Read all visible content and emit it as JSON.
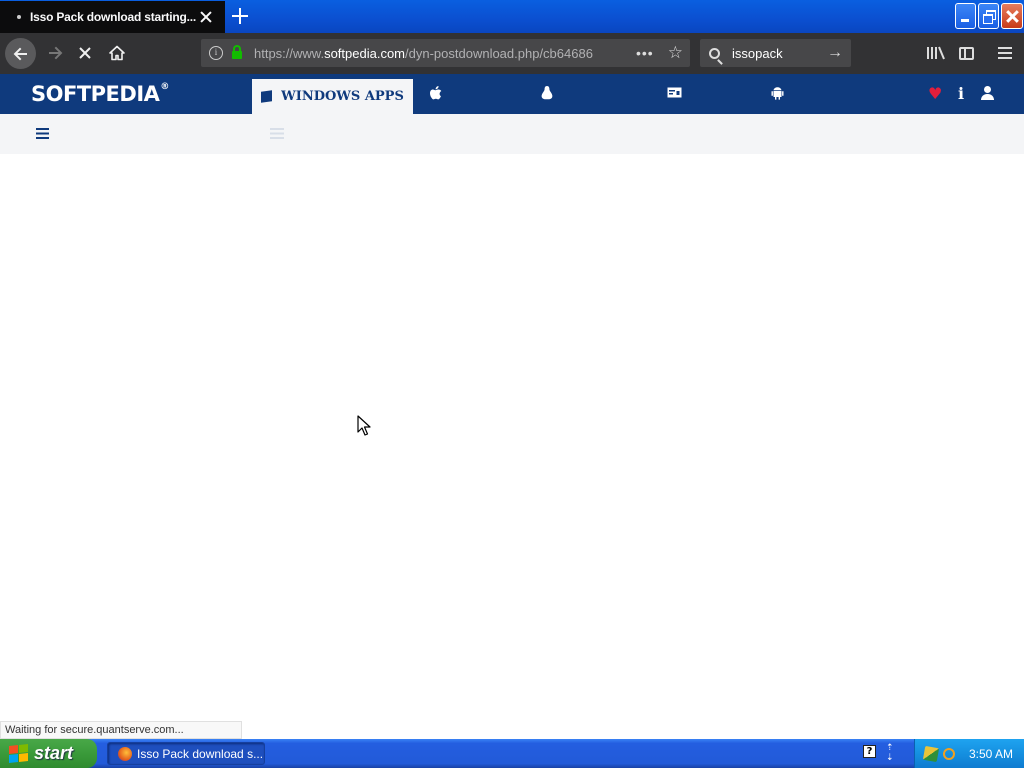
{
  "browser": {
    "tab": {
      "title": "Isso Pack download starting..."
    },
    "urlbar": {
      "url_prefix": "https://www.",
      "url_host": "softpedia.com",
      "url_path": "/dyn-postdownload.php/cb64686"
    },
    "search": {
      "value": "issopack"
    },
    "status_text": "Waiting for secure.quantserve.com..."
  },
  "softpedia": {
    "logo": "SOFTPEDIA",
    "logo_mark": "®",
    "active_category": "WINDOWS APPS",
    "categories": [
      {
        "icon": "apple-icon"
      },
      {
        "icon": "linux-icon"
      },
      {
        "icon": "games-icon"
      },
      {
        "icon": "android-icon"
      }
    ],
    "accent_color": "#0f3a7d",
    "heart_color": "#e21e3c"
  },
  "taskbar": {
    "start_label": "start",
    "task_label": "Isso Pack download s...",
    "clock": "3:50 AM"
  }
}
